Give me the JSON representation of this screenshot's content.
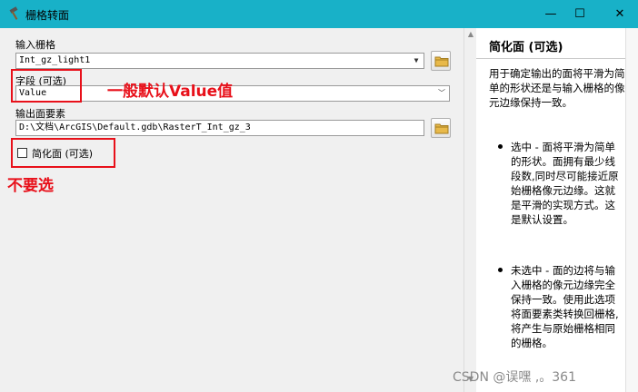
{
  "window": {
    "title": "栅格转面",
    "min_glyph": "—",
    "max_glyph": "☐",
    "close_glyph": "✕"
  },
  "form": {
    "input_raster": {
      "label": "输入栅格",
      "value": "Int_gz_light1"
    },
    "field": {
      "label": "字段 (可选)",
      "value": "Value"
    },
    "output_features": {
      "label": "输出面要素",
      "value": "D:\\文档\\ArcGIS\\Default.gdb\\RasterT_Int_gz_3"
    },
    "simplify": {
      "label": "简化面 (可选)",
      "checked": false
    }
  },
  "annotations": {
    "field_note": "一般默认Value值",
    "simplify_note": "不要选",
    "color": "#e8101a"
  },
  "help": {
    "title": "简化面 (可选)",
    "description": "用于确定输出的面将平滑为简单的形状还是与输入栅格的像元边缘保持一致。",
    "items": [
      "选中 - 面将平滑为简单的形状。面拥有最少线段数,同时尽可能接近原始栅格像元边缘。这就是平滑的实现方式。这是默认设置。",
      "未选中 - 面的边将与输入栅格的像元边缘完全保持一致。使用此选项将面要素类转换回栅格,将产生与原始栅格相同的栅格。"
    ]
  },
  "watermark": "CSDN @误嘿 ,。361",
  "colors": {
    "titlebar": "#18b1c8",
    "panel": "#f0f0f0"
  }
}
